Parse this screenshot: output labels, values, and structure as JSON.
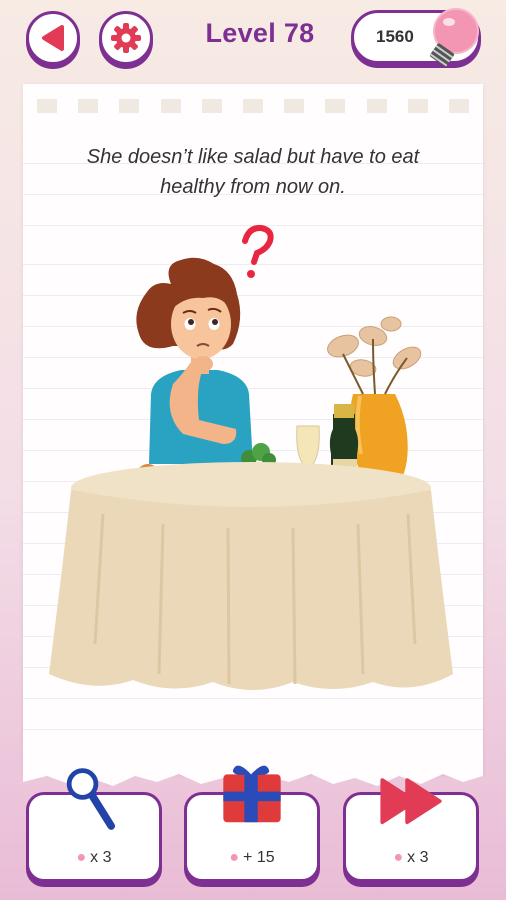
{
  "header": {
    "level_label": "Level 78",
    "hint_count": "1560"
  },
  "puzzle": {
    "question": "She doesn’t like salad but have to eat healthy from now on."
  },
  "tools": [
    {
      "name": "magnifier",
      "cost_label": "x 3"
    },
    {
      "name": "gift",
      "cost_label": "+ 15"
    },
    {
      "name": "skip",
      "cost_label": "x 3"
    }
  ],
  "colors": {
    "accent": "#7d2f92",
    "back_red": "#e23b56",
    "hint_pink": "#f296b3"
  },
  "icons": {
    "back": "back-arrow-icon",
    "settings": "gear-icon",
    "hint": "lightbulb-icon",
    "magnifier": "magnifier-icon",
    "gift": "gift-icon",
    "skip": "fast-forward-icon",
    "cost": "lightbulb-small-icon"
  }
}
